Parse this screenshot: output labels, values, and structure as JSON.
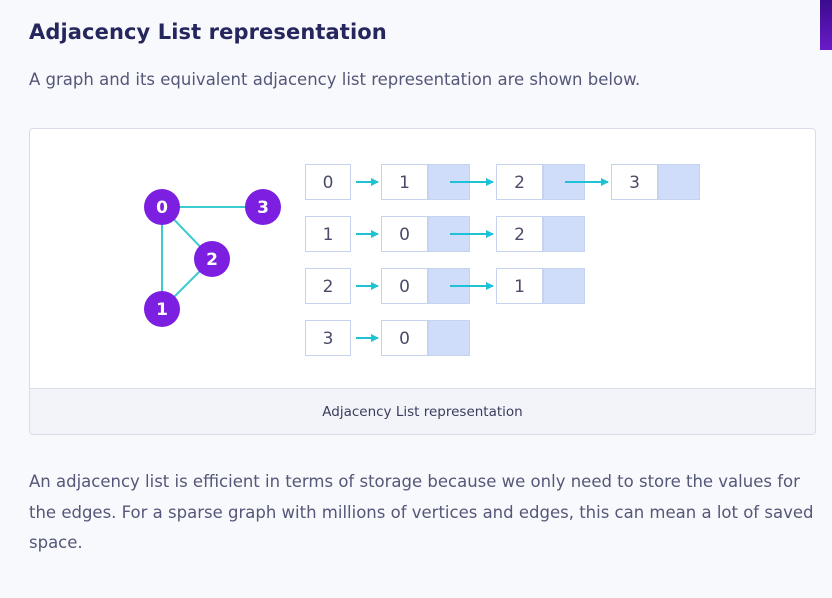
{
  "heading": "Adjacency List representation",
  "intro": "A graph and its equivalent adjacency list representation are shown below.",
  "figure": {
    "caption": "Adjacency List representation",
    "graph": {
      "vertices": [
        "0",
        "3",
        "2",
        "1"
      ],
      "edges": [
        [
          "0",
          "3"
        ],
        [
          "0",
          "2"
        ],
        [
          "0",
          "1"
        ],
        [
          "2",
          "1"
        ]
      ]
    },
    "adjacency_list": [
      {
        "head": "0",
        "nodes": [
          "1",
          "2",
          "3"
        ]
      },
      {
        "head": "1",
        "nodes": [
          "0",
          "2"
        ]
      },
      {
        "head": "2",
        "nodes": [
          "0",
          "1"
        ]
      },
      {
        "head": "3",
        "nodes": [
          "0"
        ]
      }
    ],
    "colors": {
      "vertex": "#7c1fe0",
      "edge": "#3ccbd1",
      "pointer_cell": "#cfdcfa",
      "cell_border": "#c6d3ef",
      "arrow": "#1ec2d4"
    }
  },
  "paragraph": "An adjacency list is efficient in terms of storage because we only need to store the values for the edges. For a sparse graph with millions of vertices and edges, this can mean a lot of saved space."
}
